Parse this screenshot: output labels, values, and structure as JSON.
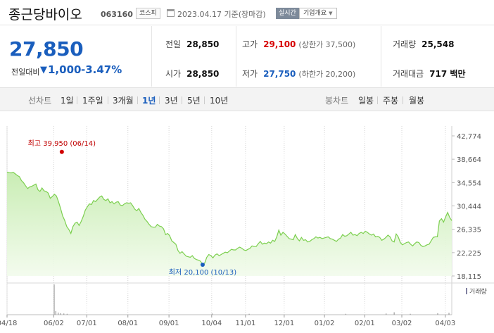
{
  "header": {
    "stock_name": "종근당바이오",
    "stock_code": "063160",
    "market": "코스피",
    "date_text": "2023.04.17 기준(장마감)",
    "realtime_label": "실시간",
    "company_info_label": "기업개요"
  },
  "price": {
    "current": "27,850",
    "change_label": "전일대비",
    "change_value": "1,000",
    "change_rate": "-3.47%"
  },
  "stats": {
    "prev_close_label": "전일",
    "prev_close": "28,850",
    "high_label": "고가",
    "high": "29,100",
    "upper_limit": "(상한가 37,500)",
    "volume_label": "거래량",
    "volume": "25,548",
    "open_label": "시가",
    "open": "28,850",
    "low_label": "저가",
    "low": "27,750",
    "lower_limit": "(하한가 20,200)",
    "amount_label": "거래대금",
    "amount": "717 백만"
  },
  "period_bar": {
    "line_chart_label": "선차트",
    "periods": [
      "1일",
      "1주일",
      "3개월",
      "1년",
      "3년",
      "5년",
      "10년"
    ],
    "active_period": "1년",
    "candle_chart_label": "봉차트",
    "candles": [
      "일봉",
      "주봉",
      "월봉"
    ]
  },
  "chart_data": {
    "type": "area",
    "y_ticks": [
      "42,774",
      "38,664",
      "34,554",
      "30,444",
      "26,335",
      "22,225",
      "18,115"
    ],
    "y_tick_values": [
      42774,
      38664,
      34554,
      30444,
      26335,
      22225,
      18115
    ],
    "ylim": [
      18115,
      42774
    ],
    "x_ticks": [
      "04/18",
      "06/02",
      "07/01",
      "08/01",
      "09/01",
      "10/04",
      "11/01",
      "12/01",
      "01/02",
      "02/01",
      "03/02",
      "04/03"
    ],
    "max_annotation": "최고 39,950 (06/14)",
    "max_value": 39950,
    "min_annotation": "최저 20,100 (10/13)",
    "min_value": 20100,
    "volume_label": "거래량",
    "series": [
      {
        "values": [
          36400,
          36300,
          36250,
          36350,
          36100,
          35800,
          35600,
          34900,
          34550,
          34000,
          33500,
          33800,
          33900,
          34100,
          34300,
          33300,
          33000,
          33600,
          33100,
          33000,
          32700,
          31800,
          32100,
          32500,
          32200,
          31200,
          30000,
          28700,
          27900,
          26800,
          26300,
          25600,
          26800,
          27400,
          27600,
          27000,
          27700,
          28600,
          29700,
          30300,
          30800,
          30700,
          31400,
          31200,
          31600,
          32000,
          32200,
          31600,
          31400,
          31700,
          31000,
          31200,
          30800,
          31100,
          31200,
          30600,
          30500,
          30800,
          31000,
          30900,
          31000,
          30500,
          29900,
          29600,
          30000,
          29300,
          28800,
          28100,
          27700,
          27200,
          26800,
          26700,
          26700,
          27200,
          26900,
          26800,
          26400,
          25400,
          25600,
          25200,
          24300,
          24000,
          23700,
          22600,
          22100,
          22400,
          22000,
          21600,
          21500,
          21400,
          21700,
          21200,
          21000,
          20900,
          20700,
          20100,
          20400,
          21400,
          21900,
          21700,
          21300,
          21800,
          22000,
          21700,
          21900,
          22100,
          22300,
          22200,
          22500,
          22800,
          22700,
          22700,
          23000,
          23200,
          23000,
          22700,
          22600,
          22800,
          23000,
          23400,
          23300,
          23300,
          23800,
          24200,
          23700,
          23900,
          23800,
          24100,
          23900,
          24400,
          24200,
          25000,
          26200,
          25300,
          25800,
          25500,
          25100,
          24700,
          24600,
          24500,
          25400,
          24700,
          24300,
          24900,
          24400,
          24500,
          24100,
          24200,
          24500,
          24700,
          25000,
          24800,
          24900,
          24700,
          24800,
          24900,
          25000,
          24700,
          24600,
          24400,
          24200,
          24600,
          24800,
          25400,
          25100,
          25200,
          25500,
          25800,
          25300,
          25400,
          25200,
          25600,
          25800,
          25600,
          26000,
          25800,
          25500,
          25300,
          25500,
          25000,
          25100,
          24900,
          24400,
          24600,
          24900,
          25300,
          25000,
          24300,
          24100,
          25500,
          25000,
          24000,
          23600,
          23800,
          24000,
          24100,
          23700,
          23400,
          23800,
          24100,
          24000,
          23500,
          23300,
          23400,
          23600,
          23700,
          24300,
          24900,
          25000,
          25000,
          27800,
          28200,
          27600,
          28500,
          29300,
          28400,
          27850
        ]
      }
    ],
    "volume": [
      1,
      1,
      1,
      1,
      1,
      1,
      1,
      1,
      1,
      1,
      1,
      1,
      1,
      1,
      1,
      1,
      1,
      1,
      1,
      1,
      1,
      1,
      1,
      1,
      1,
      1,
      1,
      1,
      1,
      1,
      1,
      1,
      1,
      1,
      1,
      1,
      1,
      1,
      1,
      1,
      1,
      1,
      1,
      1,
      1,
      1,
      1,
      1,
      1,
      1,
      1,
      1,
      1,
      1,
      1,
      1,
      1,
      1,
      1,
      1,
      1,
      1,
      1,
      1,
      1,
      1,
      1,
      1,
      1,
      1,
      1,
      1,
      1,
      1,
      1,
      1,
      1,
      1,
      1,
      1,
      1,
      1,
      1,
      1,
      1,
      1,
      1,
      1,
      1,
      1,
      1,
      1,
      1,
      1,
      1,
      1,
      1,
      1,
      1,
      1,
      1,
      1,
      1,
      1,
      1,
      1,
      1,
      1,
      1,
      1,
      1,
      1,
      1,
      1,
      1,
      1,
      1,
      1,
      1,
      1,
      1,
      1,
      1,
      1,
      1,
      1,
      1,
      1,
      1,
      1,
      1,
      1,
      1,
      1,
      1,
      1,
      1,
      1,
      1,
      1,
      1,
      1,
      1,
      1,
      1,
      1,
      1,
      1,
      1,
      1,
      1,
      1,
      1,
      1,
      1,
      1,
      1,
      1,
      1,
      1,
      1,
      1,
      1,
      1,
      1,
      1,
      1,
      1,
      1,
      1,
      1,
      1,
      1,
      1,
      1,
      1,
      1,
      1,
      1,
      1,
      1,
      1,
      1,
      1,
      1,
      1,
      1,
      1,
      1,
      1,
      1,
      1,
      1,
      1,
      1,
      1,
      1,
      1,
      1,
      1,
      1,
      1,
      1,
      1,
      1,
      1,
      1,
      1,
      1,
      1,
      1,
      1,
      1,
      1,
      1,
      1,
      1,
      1,
      1,
      1,
      1,
      1,
      1,
      1,
      1,
      1,
      1,
      1
    ]
  }
}
